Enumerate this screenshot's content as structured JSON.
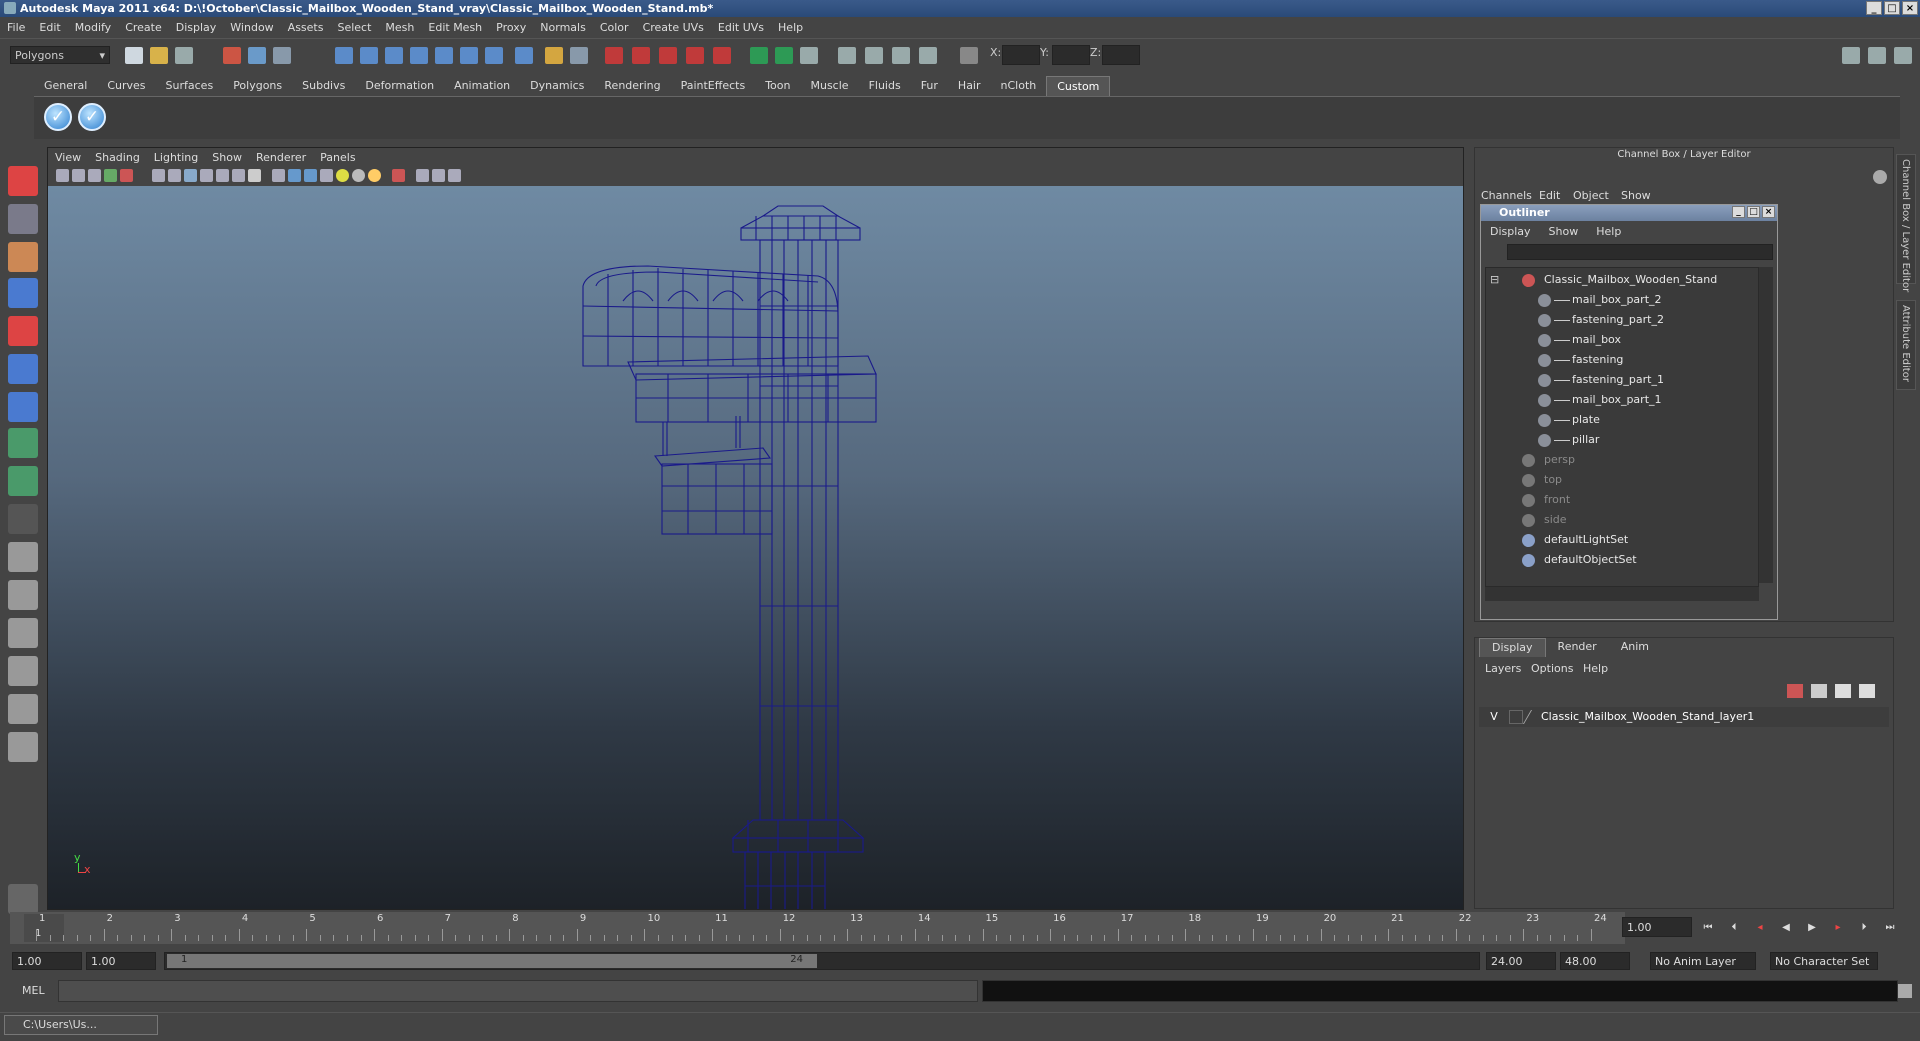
{
  "window": {
    "title": "Autodesk Maya 2011 x64: D:\\!October\\Classic_Mailbox_Wooden_Stand_vray\\Classic_Mailbox_Wooden_Stand.mb*"
  },
  "menubar": [
    "File",
    "Edit",
    "Modify",
    "Create",
    "Display",
    "Window",
    "Assets",
    "Select",
    "Mesh",
    "Edit Mesh",
    "Proxy",
    "Normals",
    "Color",
    "Create UVs",
    "Edit UVs",
    "Help"
  ],
  "statusline": {
    "mode": "Polygons",
    "x_label": "X:",
    "y_label": "Y:",
    "z_label": "Z:"
  },
  "shelf_tabs": [
    "General",
    "Curves",
    "Surfaces",
    "Polygons",
    "Subdivs",
    "Deformation",
    "Animation",
    "Dynamics",
    "Rendering",
    "PaintEffects",
    "Toon",
    "Muscle",
    "Fluids",
    "Fur",
    "Hair",
    "nCloth",
    "Custom"
  ],
  "shelf_active": "Custom",
  "viewport": {
    "menu": [
      "View",
      "Shading",
      "Lighting",
      "Show",
      "Renderer",
      "Panels"
    ],
    "axis_y": "y",
    "axis_x": "x",
    "wire_color": "#1a1a8a"
  },
  "channel_box": {
    "title": "Channel Box / Layer Editor",
    "menu": [
      "Channels",
      "Edit",
      "Object",
      "Show"
    ]
  },
  "side_tabs": [
    "Channel Box / Layer Editor",
    "Attribute Editor"
  ],
  "outliner": {
    "title": "Outliner",
    "menu": [
      "Display",
      "Show",
      "Help"
    ],
    "items": [
      {
        "label": "Classic_Mailbox_Wooden_Stand",
        "kind": "group",
        "dim": false
      },
      {
        "label": "mail_box_part_2",
        "kind": "mesh",
        "dim": false
      },
      {
        "label": "fastening_part_2",
        "kind": "mesh",
        "dim": false
      },
      {
        "label": "mail_box",
        "kind": "mesh",
        "dim": false
      },
      {
        "label": "fastening",
        "kind": "mesh",
        "dim": false
      },
      {
        "label": "fastening_part_1",
        "kind": "mesh",
        "dim": false
      },
      {
        "label": "mail_box_part_1",
        "kind": "mesh",
        "dim": false
      },
      {
        "label": "plate",
        "kind": "mesh",
        "dim": false
      },
      {
        "label": "pillar",
        "kind": "mesh",
        "dim": false
      },
      {
        "label": "persp",
        "kind": "camera",
        "dim": true
      },
      {
        "label": "top",
        "kind": "camera",
        "dim": true
      },
      {
        "label": "front",
        "kind": "camera",
        "dim": true
      },
      {
        "label": "side",
        "kind": "camera",
        "dim": true
      },
      {
        "label": "defaultLightSet",
        "kind": "set",
        "dim": false
      },
      {
        "label": "defaultObjectSet",
        "kind": "set",
        "dim": false
      }
    ]
  },
  "layer_editor": {
    "tabs": [
      "Display",
      "Render",
      "Anim"
    ],
    "active_tab": "Display",
    "menu": [
      "Layers",
      "Options",
      "Help"
    ],
    "layer": {
      "visible": "V",
      "name": "Classic_Mailbox_Wooden_Stand_layer1"
    }
  },
  "timeline": {
    "frames": [
      "1",
      "2",
      "3",
      "4",
      "5",
      "6",
      "7",
      "8",
      "9",
      "10",
      "11",
      "12",
      "13",
      "14",
      "15",
      "16",
      "17",
      "18",
      "19",
      "20",
      "21",
      "22",
      "23",
      "24"
    ],
    "current_frame": "1.00",
    "current_marker": "1"
  },
  "range": {
    "start": "1.00",
    "start_inner": "1.00",
    "slider_start": "1",
    "slider_end": "24",
    "end_inner": "24.00",
    "end": "48.00",
    "anim_layer": "No Anim Layer",
    "char_set": "No Character Set"
  },
  "cmdline": {
    "label": "MEL"
  },
  "taskbar": {
    "item": "C:\\Users\\Us..."
  }
}
